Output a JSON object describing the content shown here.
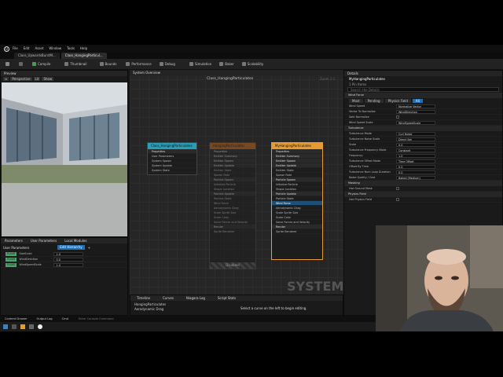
{
  "menu": [
    "File",
    "Edit",
    "Asset",
    "Window",
    "Tools",
    "Help"
  ],
  "tabs": [
    "Class_UpwardsBurstM...",
    "Class_HangingParticul..."
  ],
  "toolbar": [
    "Compile",
    "Thumbnail",
    "Bounds",
    "Performance",
    "Debug",
    "Simulation",
    "Baker",
    "Scalability"
  ],
  "preview": {
    "title": "Preview",
    "mode": "Perspective",
    "lit": "Lit",
    "show": "Show"
  },
  "system_overview": {
    "tab": "System Overview",
    "system_name": "Class_HangingParticulates",
    "watermark": "SYSTEM",
    "zoom": "Zoom 1:1"
  },
  "system_node": {
    "title": "Class_HangingParticulates",
    "rows": [
      "Properties",
      "User Parameters",
      "System Spawn",
      "System Update",
      "System State"
    ]
  },
  "emitter_ghost": {
    "title": "HangingParticulates",
    "rows": [
      "Properties",
      "Emitter Summary",
      "Emitter Spawn",
      "Emitter Update",
      "Emitter State",
      "Spawn Rate",
      "Particle Spawn",
      "Initialize Particle",
      "Shape Location",
      "Particle Update",
      "Particle State",
      "Wind Force",
      "Aerodynamic Drag",
      "Scale Sprite Size",
      "Scale Color",
      "Solve Forces and Velocity",
      "Render",
      "Sprite Renderer"
    ],
    "status": "Disabled"
  },
  "emitter_node": {
    "title": "MyHangingParticulates",
    "scope": "Stage",
    "rows": [
      "Properties",
      "Emitter Summary",
      "Emitter Spawn",
      "Emitter Update",
      "Emitter State",
      "Spawn Rate",
      "Particle Spawn",
      "Initialize Particle",
      "Shape Location",
      "Particle Update",
      "Particle State",
      "Wind Force",
      "Aerodynamic Drag",
      "Scale Sprite Size",
      "Scale Color",
      "Solve Forces and Velocity",
      "Render",
      "Sprite Renderer"
    ]
  },
  "params": {
    "tabs": [
      "Parameters",
      "User Parameters",
      "Local Modules"
    ],
    "section": "User Parameters",
    "edit_label": "Edit Hierarchy",
    "rows": [
      {
        "tag": "FLOAT",
        "name": "SizeScale",
        "value": "1.0"
      },
      {
        "tag": "FLOAT",
        "name": "WindDirection",
        "value": "0.0"
      },
      {
        "tag": "FLOAT",
        "name": "WindSpeedScale",
        "value": "1.0"
      }
    ]
  },
  "timeline": {
    "tabs": [
      "Timeline",
      "Curves",
      "Niagara Log",
      "Script Stats"
    ],
    "items": [
      "HangingParticulates",
      "Aerodynamic Drag",
      "Scale Sprite Size",
      "Scale Color",
      "MyHangingParticulates",
      "Aerodynamic Drag"
    ],
    "count": "17 items",
    "hint": "Select a curve on the left to begin editing."
  },
  "details": {
    "title": "Details",
    "object": "MyHangingParticulates",
    "sub": "1 Pin Items",
    "search": "Search the Details",
    "section": "Wind Force",
    "filters": [
      "Most",
      "Pending",
      "Physics Field",
      "All"
    ],
    "props": [
      {
        "k": "Wind Speed",
        "v": "Normalize Vector"
      },
      {
        "k": "Vector To Normalize",
        "v": "WindDirection"
      },
      {
        "k": "Safe Normalize",
        "v": ""
      },
      {
        "k": "Wind Speed Scale",
        "v": "WindSpeedScale"
      },
      {
        "k": "Turbulence",
        "v": ""
      },
      {
        "k": "Turbulence Mode",
        "v": "Curl Noise"
      },
      {
        "k": "Turbulence Noise Scale",
        "v": "Direct Set"
      },
      {
        "k": "Scale",
        "v": "0.0"
      },
      {
        "k": "Turbulence Frequency Mode",
        "v": "Constant"
      },
      {
        "k": "Frequency",
        "v": "1.0"
      },
      {
        "k": "Turbulence Offset Mode",
        "v": "Time Offset"
      },
      {
        "k": "Offset By Time",
        "v": "0.0"
      },
      {
        "k": "Turbulence Num Loop Duration",
        "v": "0.0"
      },
      {
        "k": "Noise Quality / Cost",
        "v": "Baked (Medium)"
      },
      {
        "k": "Masking",
        "v": ""
      },
      {
        "k": "Use Ground Mask",
        "v": ""
      },
      {
        "k": "Physics Field",
        "v": ""
      },
      {
        "k": "Use Physics Field",
        "v": ""
      }
    ]
  },
  "status": {
    "drawer": "Content Drawer",
    "log": "Output Log",
    "cmd": "Cmd",
    "console_placeholder": "Enter Console Command"
  }
}
